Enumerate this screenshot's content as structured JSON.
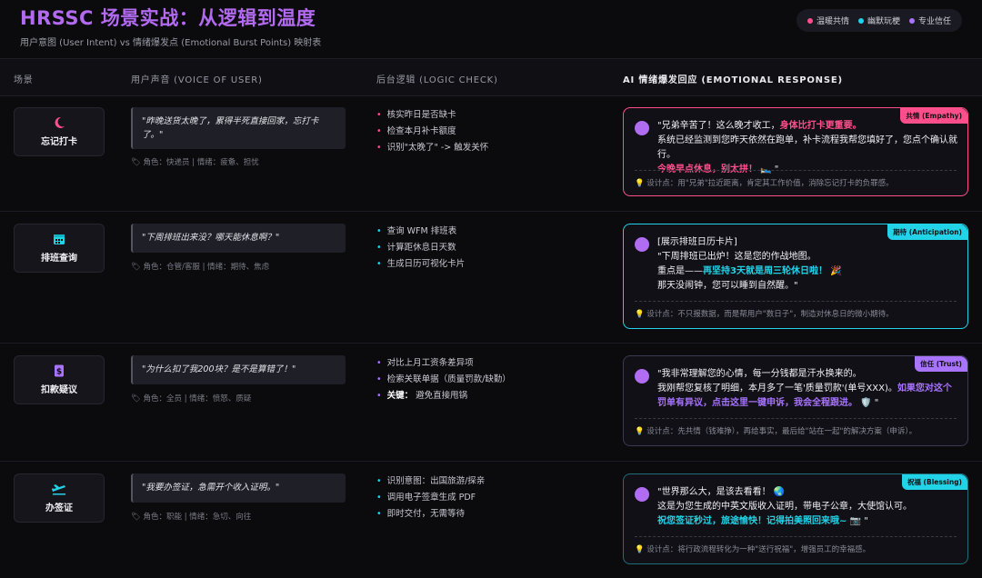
{
  "header": {
    "title": "HRSSC 场景实战：从逻辑到温度",
    "subtitle": "用户意图 (User Intent) vs 情绪爆发点 (Emotional Burst Points) 映射表"
  },
  "legend": [
    {
      "label": "温暖共情",
      "color": "#ff4f8b"
    },
    {
      "label": "幽默玩梗",
      "color": "#22d3e8"
    },
    {
      "label": "专业信任",
      "color": "#a873ff"
    }
  ],
  "columns": {
    "scene": "场景",
    "voice": "用户声音 (VOICE OF USER)",
    "logic": "后台逻辑 (LOGIC CHECK)",
    "response": "AI 情绪爆发回应 (EMOTIONAL RESPONSE)"
  },
  "rows": [
    {
      "scene": {
        "label": "忘记打卡",
        "icon": "moon-icon",
        "color": "#ff4f8b"
      },
      "voice": "\"昨晚送货太晚了，累得半死直接回家，忘打卡了。\"",
      "role": "角色：快递员 | 情绪：疲惫、担忧",
      "logic": [
        "核实昨日是否缺卡",
        "检查本月补卡额度",
        "识别\"太晚了\" -> 触发关怀"
      ],
      "tag": "共情 (Empathy)",
      "accent": "#ff4f8b",
      "response": {
        "l1a": "\"兄弟辛苦了！这么晚才收工，",
        "l1b": "身体比打卡更重要。",
        "l2": "系统已经监测到您昨天依然在跑单，补卡流程我帮您填好了，您点个确认就行。",
        "l3a": "今晚早点休息，别太拼！",
        "l3b": " 🛌 \""
      },
      "note": "设计点：用\"兄弟\"拉近距离，肯定其工作价值，消除忘记打卡的负罪感。"
    },
    {
      "scene": {
        "label": "排班查询",
        "icon": "calendar-icon",
        "color": "#22d3e8"
      },
      "voice": "\"下周排班出来没？哪天能休息啊？\"",
      "role": "角色：仓管/客服 | 情绪：期待、焦虑",
      "logic": [
        "查询 WFM 排班表",
        "计算距休息日天数",
        "生成日历可视化卡片"
      ],
      "tag": "期待 (Anticipation)",
      "accent": "#22d3e8",
      "response": {
        "l0": "[展示排班日历卡片]",
        "l1": "\"下周排班已出炉！这是您的作战地图。",
        "l2a": "重点是——",
        "l2b": "再坚持3天就是周三轮休日啦！",
        "l2c": " 🎉",
        "l3": "那天没闹钟，您可以睡到自然醒。\""
      },
      "note": "设计点：不只报数据，而是帮用户\"数日子\"，制造对休息日的微小期待。"
    },
    {
      "scene": {
        "label": "扣款疑议",
        "icon": "money-icon",
        "color": "#a873ff"
      },
      "voice": "\"为什么扣了我200块？是不是算错了！\"",
      "role": "角色：全员 | 情绪：愤怒、质疑",
      "logic": [
        "对比上月工资条差异项",
        "检索关联单据（质量罚款/缺勤）"
      ],
      "logicKeyLabel": "关键：",
      "logicKey": "避免直接甩锅",
      "tag": "信任 (Trust)",
      "accent": "#a873ff",
      "response": {
        "l1": "\"我非常理解您的心情，每一分钱都是汗水换来的。",
        "l2a": "我刚帮您复核了明细，本月多了一笔'质量罚款'(单号XXX)。",
        "l2b": "如果您对这个罚单有异议，点击这里一键申诉，我会全程跟进。",
        "l2c": " 🛡️ \""
      },
      "note": "设计点：先共情（钱难挣），再给事实，最后给\"站在一起\"的解决方案（申诉）。"
    },
    {
      "scene": {
        "label": "办签证",
        "icon": "plane-icon",
        "color": "#22d3e8"
      },
      "voice": "\"我要办签证，急需开个收入证明。\"",
      "role": "角色：职能 | 情绪：急切、向往",
      "logic": [
        "识别意图：出国旅游/探亲",
        "调用电子签章生成 PDF",
        "即时交付，无需等待"
      ],
      "tag": "祝福 (Blessing)",
      "accent": "#22d3e8",
      "response": {
        "l1": "\"世界那么大，是该去看看！ 🌏",
        "l2": "这是为您生成的中英文版收入证明，带电子公章，大使馆认可。",
        "l3a": "祝您签证秒过，旅途愉快！记得拍美照回来哦~",
        "l3b": " 📷 \""
      },
      "note": "设计点：将行政流程转化为一种\"送行祝福\"，增强员工的幸福感。"
    }
  ]
}
